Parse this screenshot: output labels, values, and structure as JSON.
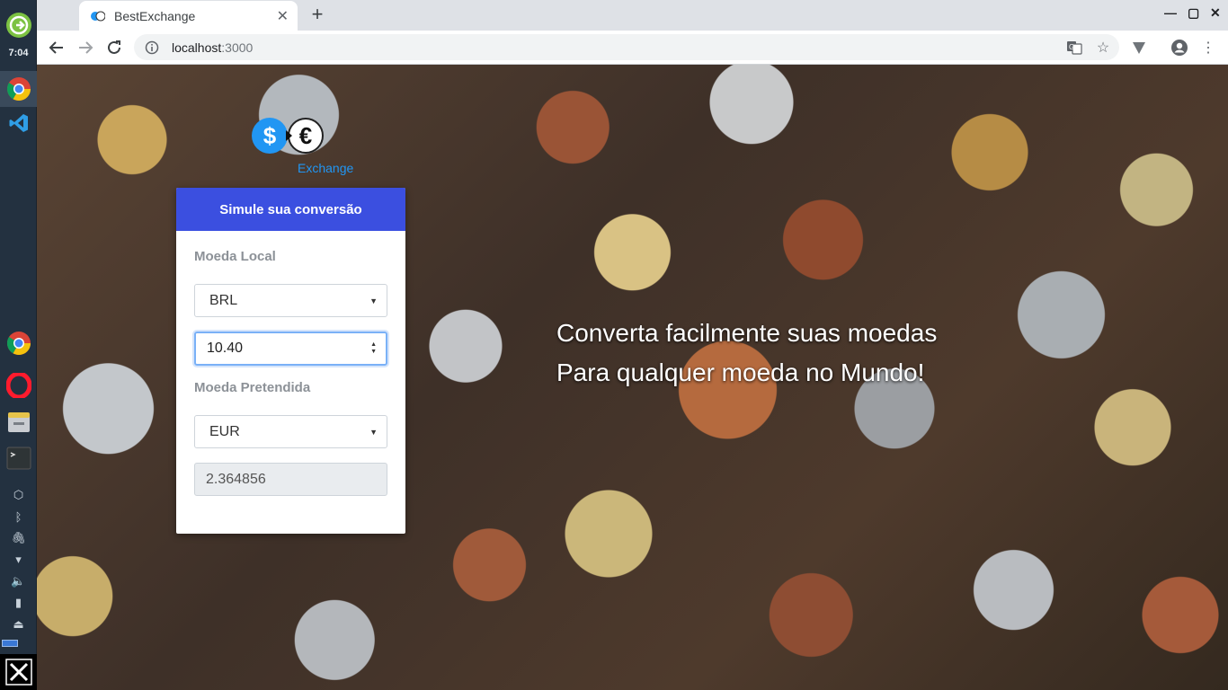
{
  "dock": {
    "clock": "7:04",
    "apps": [
      "clock-app-icon",
      "chrome-icon",
      "vscode-icon",
      "chrome-icon",
      "opera-icon",
      "files-icon",
      "terminal-icon"
    ],
    "tray": [
      "dropbox-icon",
      "bluetooth-icon",
      "clip-icon",
      "wifi-icon",
      "volume-icon",
      "battery-icon",
      "eject-icon"
    ]
  },
  "browser": {
    "tab_title": "BestExchange",
    "url_host": "localhost",
    "url_port": ":3000"
  },
  "logo": {
    "word": "Exchange",
    "dollar": "$",
    "euro": "€"
  },
  "card": {
    "header": "Simule sua conversão",
    "local_label": "Moeda Local",
    "local_value": "BRL",
    "amount": "10.40",
    "target_label": "Moeda Pretendida",
    "target_value": "EUR",
    "result": "2.364856"
  },
  "tagline": {
    "line1": "Converta facilmente suas moedas",
    "line2": "Para qualquer moeda no Mundo!"
  },
  "colors": {
    "card_header": "#3b4fe0",
    "logo_blue": "#2196f3",
    "dock_bg": "#233140"
  }
}
